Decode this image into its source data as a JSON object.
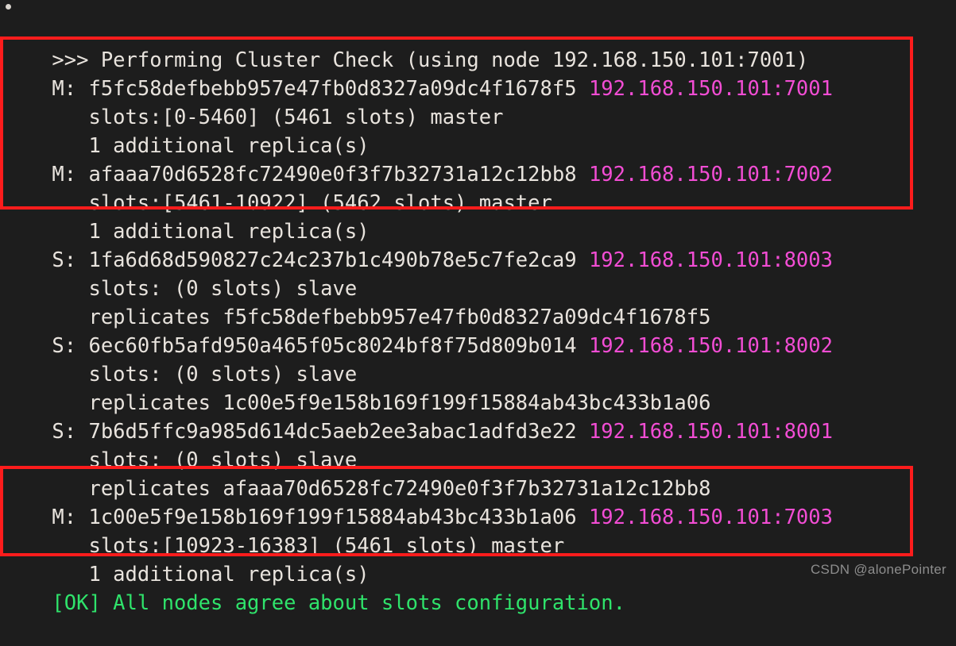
{
  "terminal": {
    "background_color": "#1d1d1d",
    "text_color": "#e8e3dd",
    "address_color": "#f24dd4",
    "ok_color": "#2fe36b",
    "annotation_color": "#fd1c1c",
    "cursor_dot": "•",
    "header": ">>> Performing Cluster Check (using node 192.168.150.101:7001)",
    "footer": "[OK] All nodes agree about slots configuration."
  },
  "nodes": [
    {
      "role_prefix": "M:",
      "node_id": "f5fc58defbebb957e47fb0d8327a09dc4f1678f5",
      "address": "192.168.150.101:7001",
      "detail_1": "   slots:[0-5460] (5461 slots) master",
      "detail_2": "   1 additional replica(s)",
      "highlighted": true
    },
    {
      "role_prefix": "M:",
      "node_id": "afaaa70d6528fc72490e0f3f7b32731a12c12bb8",
      "address": "192.168.150.101:7002",
      "detail_1": "   slots:[5461-10922] (5462 slots) master",
      "detail_2": "   1 additional replica(s)",
      "highlighted": true
    },
    {
      "role_prefix": "S:",
      "node_id": "1fa6d68d590827c24c237b1c490b78e5c7fe2ca9",
      "address": "192.168.150.101:8003",
      "detail_1": "   slots: (0 slots) slave",
      "detail_2": "   replicates f5fc58defbebb957e47fb0d8327a09dc4f1678f5",
      "highlighted": false
    },
    {
      "role_prefix": "S:",
      "node_id": "6ec60fb5afd950a465f05c8024bf8f75d809b014",
      "address": "192.168.150.101:8002",
      "detail_1": "   slots: (0 slots) slave",
      "detail_2": "   replicates 1c00e5f9e158b169f199f15884ab43bc433b1a06",
      "highlighted": false
    },
    {
      "role_prefix": "S:",
      "node_id": "7b6d5ffc9a985d614dc5aeb2ee3abac1adfd3e22",
      "address": "192.168.150.101:8001",
      "detail_1": "   slots: (0 slots) slave",
      "detail_2": "   replicates afaaa70d6528fc72490e0f3f7b32731a12c12bb8",
      "highlighted": false
    },
    {
      "role_prefix": "M:",
      "node_id": "1c00e5f9e158b169f199f15884ab43bc433b1a06",
      "address": "192.168.150.101:7003",
      "detail_1": "   slots:[10923-16383] (5461 slots) master",
      "detail_2": "   1 additional replica(s)",
      "highlighted": true
    }
  ],
  "node_lines": {
    "n0_head": "M: f5fc58defbebb957e47fb0d8327a09dc4f1678f5 ",
    "n0_addr": "192.168.150.101:7001",
    "n0_d1": "   slots:[0-5460] (5461 slots) master",
    "n0_d2": "   1 additional replica(s)",
    "n1_head": "M: afaaa70d6528fc72490e0f3f7b32731a12c12bb8 ",
    "n1_addr": "192.168.150.101:7002",
    "n1_d1": "   slots:[5461-10922] (5462 slots) master",
    "n1_d2": "   1 additional replica(s)",
    "n2_head": "S: 1fa6d68d590827c24c237b1c490b78e5c7fe2ca9 ",
    "n2_addr": "192.168.150.101:8003",
    "n2_d1": "   slots: (0 slots) slave",
    "n2_d2": "   replicates f5fc58defbebb957e47fb0d8327a09dc4f1678f5",
    "n3_head": "S: 6ec60fb5afd950a465f05c8024bf8f75d809b014 ",
    "n3_addr": "192.168.150.101:8002",
    "n3_d1": "   slots: (0 slots) slave",
    "n3_d2": "   replicates 1c00e5f9e158b169f199f15884ab43bc433b1a06",
    "n4_head": "S: 7b6d5ffc9a985d614dc5aeb2ee3abac1adfd3e22 ",
    "n4_addr": "192.168.150.101:8001",
    "n4_d1": "   slots: (0 slots) slave",
    "n4_d2": "   replicates afaaa70d6528fc72490e0f3f7b32731a12c12bb8",
    "n5_head": "M: 1c00e5f9e158b169f199f15884ab43bc433b1a06 ",
    "n5_addr": "192.168.150.101:7003",
    "n5_d1": "   slots:[10923-16383] (5461 slots) master",
    "n5_d2": "   1 additional replica(s)"
  },
  "watermark": {
    "text": "CSDN @alonePointer"
  }
}
